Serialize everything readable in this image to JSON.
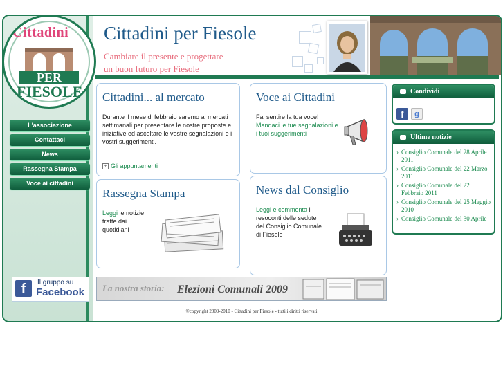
{
  "logo": {
    "top_text": "Cittadini",
    "band_text": "PER",
    "bottom_text": "FIESOLE"
  },
  "header": {
    "title": "Cittadini per Fiesole",
    "tagline_line1": "Cambiare il presente e progettare",
    "tagline_line2": "un buon futuro per Fiesole"
  },
  "nav": {
    "items": [
      {
        "label": "L'associazione"
      },
      {
        "label": "Contattaci"
      },
      {
        "label": "News"
      },
      {
        "label": "Rassegna Stampa"
      },
      {
        "label": "Voce ai cittadini"
      }
    ]
  },
  "facebook": {
    "line1": "Il gruppo su",
    "line2": "Facebook"
  },
  "boxes": {
    "mercato": {
      "title": "Cittadini... al mercato",
      "text": "Durante il mese di febbraio saremo ai mercati settimanali per presentare le nostre proposte e iniziative ed ascoltare le vostre segnalazioni e i vostri suggerimenti.",
      "link": "Gli appuntamenti"
    },
    "voce": {
      "title": "Voce ai Cittadini",
      "text": "Fai sentire la tua voce!",
      "link": "Mandaci le tue segnalazioni e i tuoi suggerimenti"
    },
    "rassegna": {
      "title": "Rassegna Stampa",
      "link": "Leggi",
      "text": "le notizie tratte dai quotidiani"
    },
    "consiglio": {
      "title": "News dal Consiglio",
      "link": "Leggi e commenta",
      "text": "i resoconti delle sedute del Consiglio Comunale di Fiesole"
    }
  },
  "sidebar": {
    "share_title": "Condividi",
    "news_title": "Ultime notizie",
    "news": [
      "Consiglio Comunale del 28 Aprile 2011",
      "Consiglio Comunale del 22 Marzo 2011",
      "Consiglio Comunale del 22 Febbraio 2011",
      "Consiglio Comunale del 25 Maggio 2010",
      "Consiglio Comunale del 30 Aprile"
    ]
  },
  "story_banner": {
    "prefix": "La nostra storia:",
    "title": "Elezioni Comunali 2009"
  },
  "footer": {
    "text": "©copyright 2009-2010 - Cittadini per Fiesole - tutti i diritti riservati"
  },
  "colors": {
    "accent_green": "#1f7a52",
    "title_blue": "#1f5a8a",
    "tagline_pink": "#e86e7e",
    "link_green": "#1a8a4e"
  }
}
